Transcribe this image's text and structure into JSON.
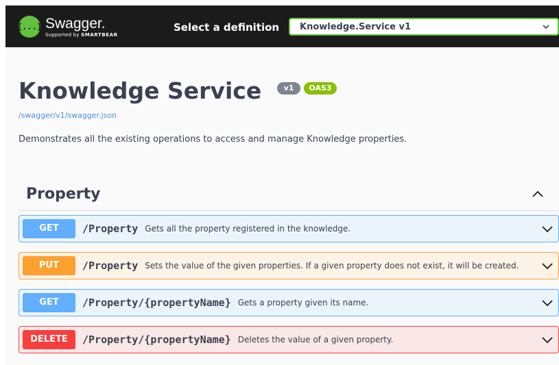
{
  "topbar": {
    "logo_mark": "{...}",
    "logo_name": "Swagger.",
    "logo_sub_prefix": "Supported by",
    "logo_sub_brand": "SMARTBEAR",
    "definition_label": "Select a definition",
    "definition_selected": "Knowledge.Service v1",
    "background_color": "#1b1b1b",
    "accent_color": "#62c23e"
  },
  "info": {
    "title": "Knowledge Service",
    "version_badge": "v1",
    "oas_badge": "OAS3",
    "spec_url": "/swagger/v1/swagger.json",
    "description": "Demonstrates all the existing operations to access and manage Knowledge properties."
  },
  "tag": {
    "name": "Property",
    "expanded": true,
    "operations": [
      {
        "method": "GET",
        "path": "/Property",
        "summary": "Gets all the property registered in the knowledge.",
        "color": "#61affe"
      },
      {
        "method": "PUT",
        "path": "/Property",
        "summary": "Sets the value of the given properties. If a given property does not exist, it will be created.",
        "color": "#fca130"
      },
      {
        "method": "GET",
        "path": "/Property/{propertyName}",
        "summary": "Gets a property given its name.",
        "color": "#61affe"
      },
      {
        "method": "DELETE",
        "path": "/Property/{propertyName}",
        "summary": "Deletes the value of a given property.",
        "color": "#f93e3e"
      }
    ]
  }
}
